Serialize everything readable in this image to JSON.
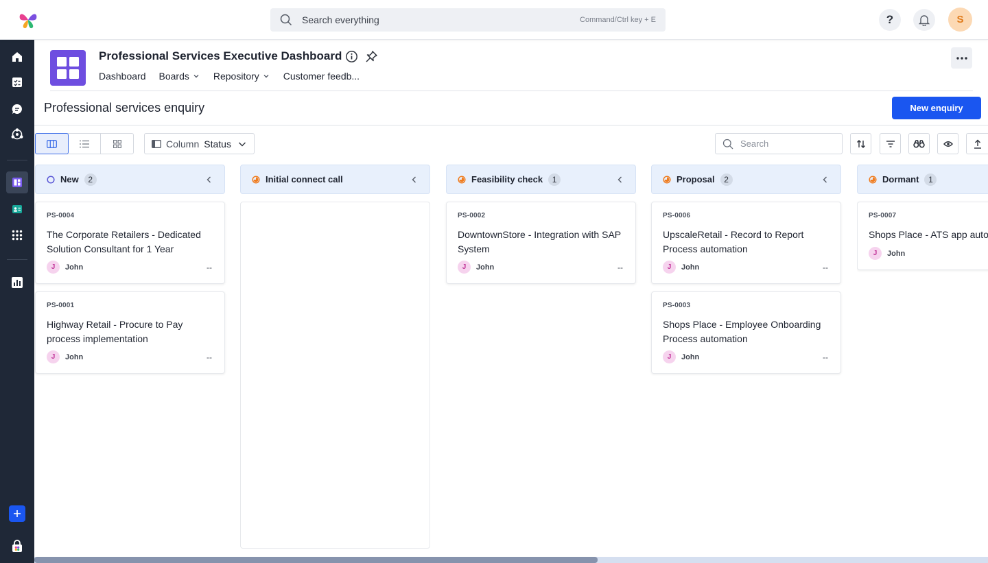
{
  "search": {
    "placeholder": "Search everything",
    "shortcut_hint": "Command/Ctrl key + E"
  },
  "topbar": {
    "help_glyph": "?",
    "user_initial": "S"
  },
  "app": {
    "title": "Professional Services Executive Dashboard",
    "nav": [
      {
        "label": "Dashboard",
        "dropdown": false
      },
      {
        "label": "Boards",
        "dropdown": true
      },
      {
        "label": "Repository",
        "dropdown": true
      },
      {
        "label": "Customer feedb...",
        "dropdown": false
      }
    ]
  },
  "page": {
    "title": "Professional services enquiry",
    "new_button": "New enquiry"
  },
  "toolbar": {
    "column_label": "Column",
    "column_value": "Status",
    "search_placeholder": "Search"
  },
  "columns": [
    {
      "name": "New",
      "count": "2",
      "status_icon": "hollow-circle",
      "color": "#5a57d6",
      "cards": [
        {
          "id": "PS-0004",
          "title": "The Corporate Retailers - Dedicated Solution Consultant for 1 Year",
          "owner_initial": "J",
          "owner": "John",
          "due": "--"
        },
        {
          "id": "PS-0001",
          "title": "Highway Retail - Procure to Pay process implementation",
          "owner_initial": "J",
          "owner": "John",
          "due": "--"
        }
      ]
    },
    {
      "name": "Initial connect call",
      "count": "",
      "status_icon": "half-circle",
      "color": "#f07c1e",
      "cards": []
    },
    {
      "name": "Feasibility check",
      "count": "1",
      "status_icon": "half-circle",
      "color": "#f07c1e",
      "cards": [
        {
          "id": "PS-0002",
          "title": "DowntownStore - Integration with SAP System",
          "owner_initial": "J",
          "owner": "John",
          "due": "--"
        }
      ]
    },
    {
      "name": "Proposal",
      "count": "2",
      "status_icon": "half-circle",
      "color": "#f07c1e",
      "cards": [
        {
          "id": "PS-0006",
          "title": "UpscaleRetail - Record to Report Process automation",
          "owner_initial": "J",
          "owner": "John",
          "due": "--"
        },
        {
          "id": "PS-0003",
          "title": "Shops Place - Employee Onboarding Process automation",
          "owner_initial": "J",
          "owner": "John",
          "due": "--"
        }
      ]
    },
    {
      "name": "Dormant",
      "count": "1",
      "status_icon": "half-circle",
      "color": "#f07c1e",
      "cards": [
        {
          "id": "PS-0007",
          "title": "Shops Place - ATS app auto",
          "owner_initial": "J",
          "owner": "John",
          "due": ""
        }
      ]
    }
  ]
}
